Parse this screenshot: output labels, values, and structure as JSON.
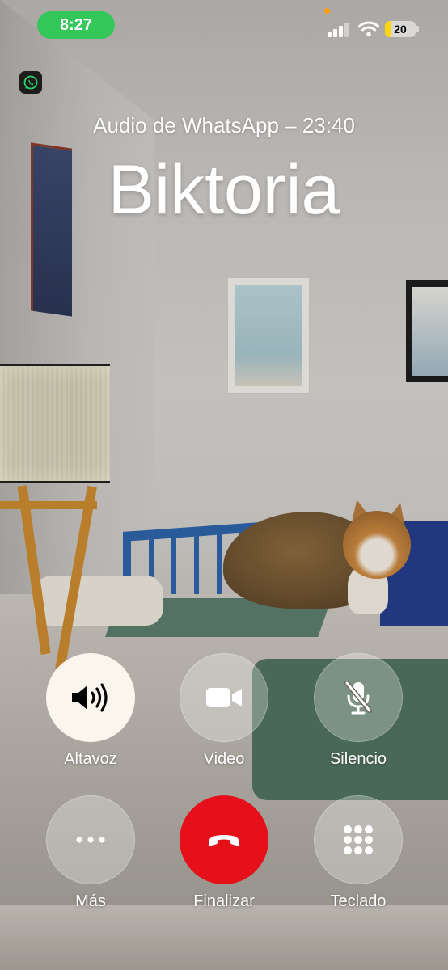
{
  "status_bar": {
    "time": "8:27",
    "battery": "20",
    "battery_level": 0.2,
    "colors": {
      "time_pill": "#34c759",
      "battery_fill": "#ffd60a",
      "privacy_dot": "#ff9f0a"
    }
  },
  "header": {
    "app_icon": "whatsapp-icon",
    "subtitle": "Audio de WhatsApp – 23:40",
    "caller_name": "Biktoria"
  },
  "controls": {
    "row1": [
      {
        "label": "Altavoz",
        "icon": "speaker-icon",
        "active": true
      },
      {
        "label": "Video",
        "icon": "video-camera-icon",
        "active": false
      },
      {
        "label": "Silencio",
        "icon": "mic-off-icon",
        "active": false
      }
    ],
    "row2": [
      {
        "label": "Más",
        "icon": "more-icon"
      },
      {
        "label": "Finalizar",
        "icon": "end-call-icon",
        "color": "#e5101a"
      },
      {
        "label": "Teclado",
        "icon": "keypad-icon"
      }
    ]
  }
}
